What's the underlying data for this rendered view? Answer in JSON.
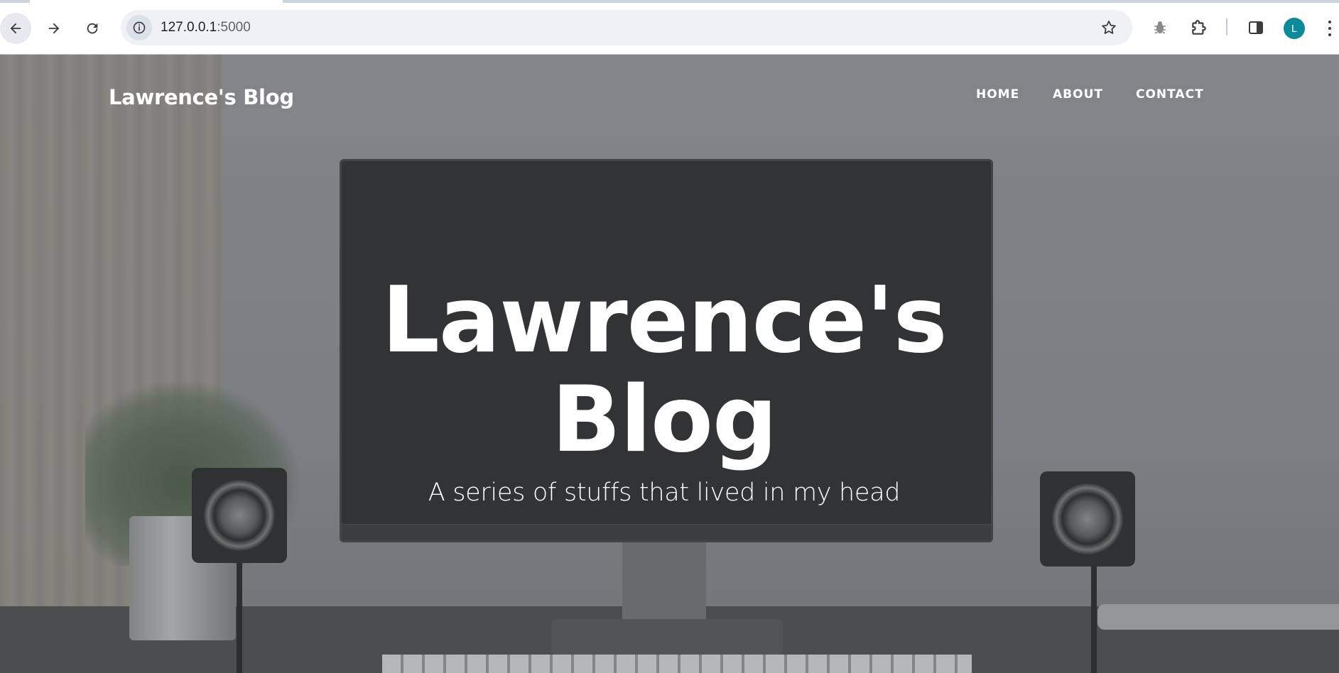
{
  "browser": {
    "url_host": "127.0.0.1",
    "url_port": ":5000",
    "profile_initial": "L"
  },
  "icons": {
    "back": "arrow-left-icon",
    "forward": "arrow-right-icon",
    "reload": "reload-icon",
    "site_info": "info-icon",
    "bookmark": "star-icon",
    "extension_bug": "bug-icon",
    "extensions": "puzzle-icon",
    "side_panel": "side-panel-icon",
    "menu": "kebab-menu-icon"
  },
  "page": {
    "brand": "Lawrence's Blog",
    "nav": {
      "home": "HOME",
      "about": "ABOUT",
      "contact": "CONTACT"
    },
    "hero": {
      "title_line1": "Lawrence's",
      "title_line2": "Blog",
      "subtitle": "A series of stuffs that lived in my head"
    }
  },
  "colors": {
    "avatar": "#0b8a9a",
    "hero_text": "#ffffff"
  }
}
